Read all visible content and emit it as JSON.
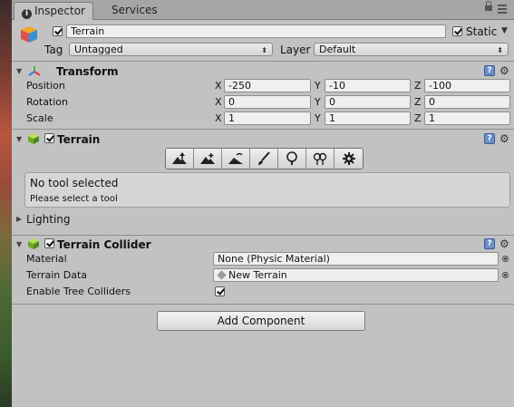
{
  "tabs": {
    "inspector": "Inspector",
    "services": "Services"
  },
  "header": {
    "name_value": "Terrain",
    "static_label": "Static",
    "tag_label": "Tag",
    "tag_value": "Untagged",
    "layer_label": "Layer",
    "layer_value": "Default"
  },
  "transform": {
    "title": "Transform",
    "rows": [
      {
        "label": "Position",
        "x": "-250",
        "y": "-10",
        "z": "-100"
      },
      {
        "label": "Rotation",
        "x": "0",
        "y": "0",
        "z": "0"
      },
      {
        "label": "Scale",
        "x": "1",
        "y": "1",
        "z": "1"
      }
    ],
    "axes": {
      "x": "X",
      "y": "Y",
      "z": "Z"
    }
  },
  "terrain": {
    "title": "Terrain",
    "tools": [
      "raise-lower-terrain",
      "paint-height",
      "smooth-height",
      "paint-texture",
      "place-trees",
      "paint-details",
      "terrain-settings"
    ],
    "help_title": "No tool selected",
    "help_text": "Please select a tool",
    "lighting_label": "Lighting"
  },
  "collider": {
    "title": "Terrain Collider",
    "material_label": "Material",
    "material_value": "None (Physic Material)",
    "data_label": "Terrain Data",
    "data_value": "New Terrain",
    "tree_label": "Enable Tree Colliders",
    "tree_checked": true
  },
  "add_component": "Add Component",
  "colors": {
    "panel": "#c2c2c2",
    "tabbar": "#a6a6a6",
    "help_icon": "#6c8fc7"
  }
}
